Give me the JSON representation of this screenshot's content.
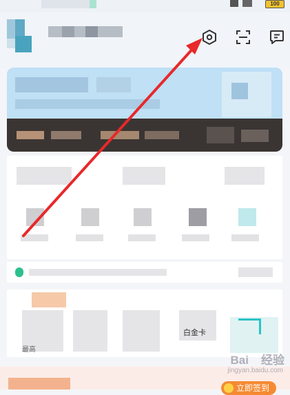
{
  "status_bar": {
    "battery": "100"
  },
  "header": {
    "settings_icon": "hexagon-gear-icon",
    "scan_icon": "scan-icon",
    "message_icon": "message-icon"
  },
  "grid_labels": {
    "item_card_label": "白金卡",
    "bottom_label": "最高"
  },
  "watermark": {
    "brand": "Bai",
    "suffix": "经验",
    "url": "jingyan.baidu.com"
  },
  "signin": {
    "label": "立即签到"
  },
  "annotation": {
    "arrow_color": "#e8282a"
  }
}
